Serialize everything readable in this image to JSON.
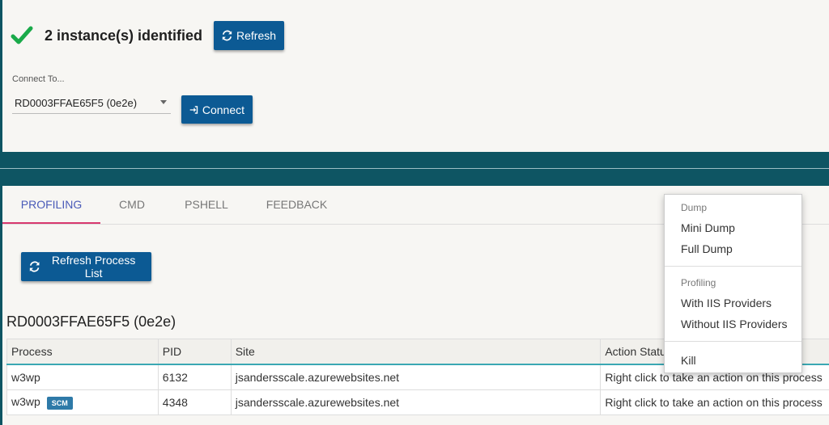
{
  "header": {
    "status_text": "2 instance(s) identified",
    "refresh_label": "Refresh",
    "status_color": "#1aaa4a"
  },
  "connect": {
    "label": "Connect To...",
    "selected_instance": "RD0003FFAE65F5 (0e2e)",
    "button_label": "Connect"
  },
  "tabs": [
    {
      "label": "PROFILING",
      "active": true
    },
    {
      "label": "CMD"
    },
    {
      "label": "PSHELL"
    },
    {
      "label": "FEEDBACK"
    }
  ],
  "main": {
    "refresh_process_label": "Refresh Process List",
    "server_title": "RD0003FFAE65F5 (0e2e)"
  },
  "table": {
    "columns": [
      "Process",
      "PID",
      "Site",
      "Action Status"
    ],
    "rows": [
      {
        "process": "w3wp",
        "badge": "",
        "pid": "6132",
        "site": "jsandersscale.azurewebsites.net",
        "action": "Right click to take an action on this process"
      },
      {
        "process": "w3wp",
        "badge": "SCM",
        "pid": "4348",
        "site": "jsandersscale.azurewebsites.net",
        "action": "Right click to take an action on this process"
      }
    ]
  },
  "context_menu": {
    "dump_header": "Dump",
    "mini_dump": "Mini Dump",
    "full_dump": "Full Dump",
    "profiling_header": "Profiling",
    "with_iis": "With IIS Providers",
    "without_iis": "Without IIS Providers",
    "kill": "Kill"
  },
  "colors": {
    "primary_button": "#0c5a94",
    "teal_band": "#0e5563",
    "active_tab": "#4a5bb8",
    "tab_underline": "#d8386e"
  }
}
